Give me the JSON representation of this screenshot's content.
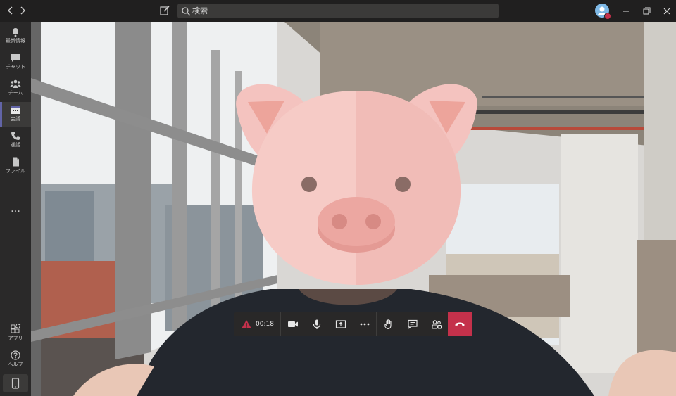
{
  "search": {
    "placeholder": "検索"
  },
  "rail": {
    "items": [
      {
        "label": "最新情報",
        "icon": "bell-icon"
      },
      {
        "label": "チャット",
        "icon": "chat-icon"
      },
      {
        "label": "チーム",
        "icon": "teams-icon"
      },
      {
        "label": "会議",
        "icon": "calendar-icon",
        "active": true
      },
      {
        "label": "通話",
        "icon": "phone-icon"
      },
      {
        "label": "ファイル",
        "icon": "file-icon"
      }
    ],
    "more": "…",
    "bottom": [
      {
        "label": "アプリ",
        "icon": "apps-icon"
      },
      {
        "label": "ヘルプ",
        "icon": "help-icon"
      }
    ]
  },
  "controls": {
    "timer": "00:18",
    "hangup_color": "#c4314b"
  },
  "colors": {
    "accent": "#6264a7",
    "alert": "#c4314b"
  }
}
